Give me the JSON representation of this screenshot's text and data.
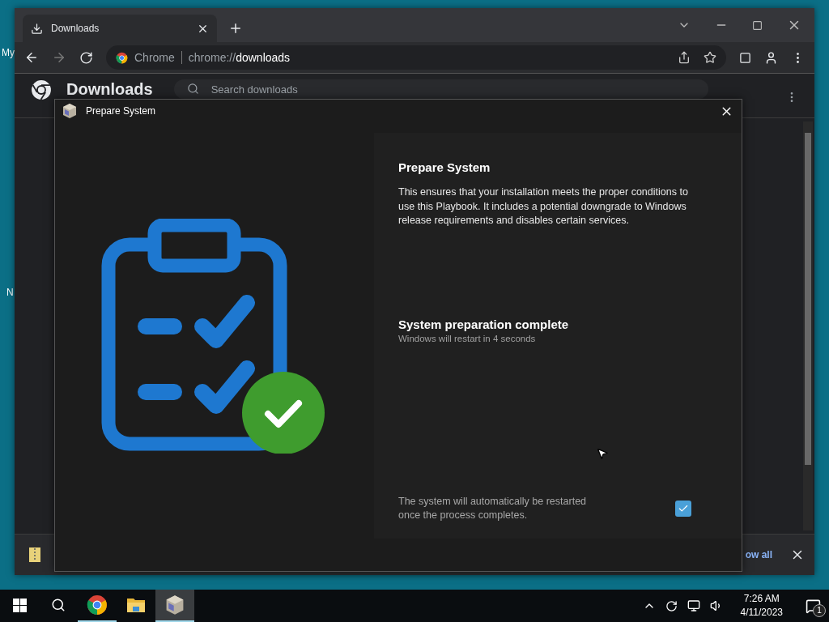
{
  "desktop": {
    "icon_labels": [
      "My",
      "N"
    ]
  },
  "browser": {
    "tab": {
      "title": "Downloads",
      "selected": true
    },
    "address": {
      "site": "Chrome",
      "url_prefix": "chrome://",
      "url_host": "downloads"
    },
    "page_title": "Downloads",
    "search": {
      "placeholder": "Search downloads"
    },
    "download_bar": {
      "link": "ow all"
    }
  },
  "dialog": {
    "title": "Prepare System",
    "heading": "Prepare System",
    "description": "This ensures that your installation meets the proper conditions to use this Playbook. It includes a potential downgrade to Windows release requirements and disables certain services.",
    "status_title": "System preparation complete",
    "status_detail": "Windows will restart in 4 seconds",
    "restart_note": "The system will automatically be restarted once the process completes.",
    "auto_restart_checked": true
  },
  "taskbar": {
    "apps": [
      {
        "kind": "chrome",
        "running": true,
        "selected": false
      },
      {
        "kind": "explorer",
        "running": false,
        "selected": false
      },
      {
        "kind": "installer",
        "running": true,
        "selected": true
      }
    ],
    "time": "7:26 AM",
    "date": "4/11/2023",
    "notification_count": "1"
  }
}
